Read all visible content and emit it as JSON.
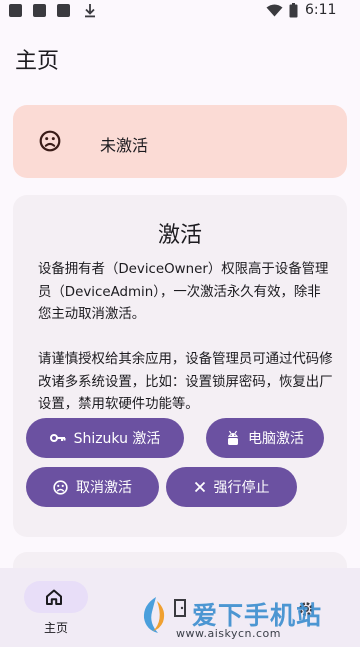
{
  "status_bar": {
    "time": "6:11",
    "notification_icons": [
      "app-icon",
      "app-icon",
      "app-icon",
      "download-icon"
    ],
    "system_icons": [
      "wifi-icon",
      "battery-icon"
    ]
  },
  "header": {
    "title": "主页"
  },
  "status_card": {
    "text": "未激活",
    "icon": "sad-face-icon",
    "color": "#fbdbd5"
  },
  "activation_card": {
    "title": "激活",
    "description": "设备拥有者（DeviceOwner）权限高于设备管理员（DeviceAdmin），一次激活永久有效，除非您主动取消激活。\n\n请谨慎授权给其余应用，设备管理员可通过代码修改诸多系统设置，比如：设置锁屏密码，恢复出厂设置，禁用软硬件功能等。",
    "buttons": {
      "shizuku": {
        "label": "Shizuku 激活",
        "icon": "key-icon"
      },
      "pc": {
        "label": "电脑激活",
        "icon": "android-icon"
      },
      "cancel": {
        "label": "取消激活",
        "icon": "sad-face-icon"
      },
      "stop": {
        "label": "强行停止",
        "icon": "close-icon"
      }
    },
    "button_color": "#6b51a1"
  },
  "bottom_nav": {
    "items": [
      {
        "label": "主页",
        "icon": "home-icon",
        "selected": true
      }
    ]
  },
  "watermark": {
    "text": "爱下手机站",
    "url": "www.aiskycn.com"
  }
}
